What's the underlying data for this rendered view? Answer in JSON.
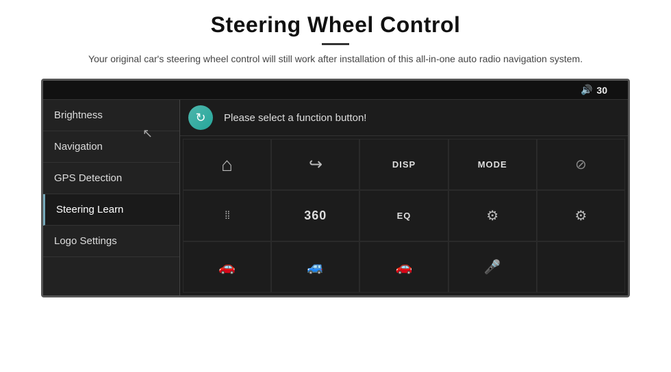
{
  "header": {
    "title": "Steering Wheel Control",
    "subtitle": "Your original car's steering wheel control will still work after installation of this all-in-one auto radio navigation system."
  },
  "topbar": {
    "volume_label": "30"
  },
  "sidebar": {
    "items": [
      {
        "id": "brightness",
        "label": "Brightness",
        "active": false
      },
      {
        "id": "navigation",
        "label": "Navigation",
        "active": false
      },
      {
        "id": "gps-detection",
        "label": "GPS Detection",
        "active": false
      },
      {
        "id": "steering-learn",
        "label": "Steering Learn",
        "active": true
      },
      {
        "id": "logo-settings",
        "label": "Logo Settings",
        "active": false
      }
    ]
  },
  "function_bar": {
    "prompt": "Please select a function button!"
  },
  "grid_buttons": [
    {
      "row": 1,
      "col": 1,
      "type": "house",
      "symbol": "⌂"
    },
    {
      "row": 1,
      "col": 2,
      "type": "back",
      "symbol": "↩"
    },
    {
      "row": 1,
      "col": 3,
      "type": "label",
      "label": "DISP"
    },
    {
      "row": 1,
      "col": 4,
      "type": "label",
      "label": "MODE"
    },
    {
      "row": 1,
      "col": 5,
      "type": "phone-off",
      "symbol": "🚫📞"
    },
    {
      "row": 2,
      "col": 1,
      "type": "tuner",
      "symbol": "⚙"
    },
    {
      "row": 2,
      "col": 2,
      "type": "label",
      "label": "360"
    },
    {
      "row": 2,
      "col": 3,
      "type": "label",
      "label": "EQ"
    },
    {
      "row": 2,
      "col": 4,
      "type": "settings2",
      "symbol": "⚙"
    },
    {
      "row": 2,
      "col": 5,
      "type": "settings3",
      "symbol": "⚙"
    },
    {
      "row": 3,
      "col": 1,
      "type": "car",
      "symbol": "🚗"
    },
    {
      "row": 3,
      "col": 2,
      "type": "car2",
      "symbol": "🚗"
    },
    {
      "row": 3,
      "col": 3,
      "type": "car3",
      "symbol": "🚗"
    },
    {
      "row": 3,
      "col": 4,
      "type": "mic",
      "symbol": "🎤"
    },
    {
      "row": 3,
      "col": 5,
      "type": "empty",
      "symbol": ""
    }
  ]
}
